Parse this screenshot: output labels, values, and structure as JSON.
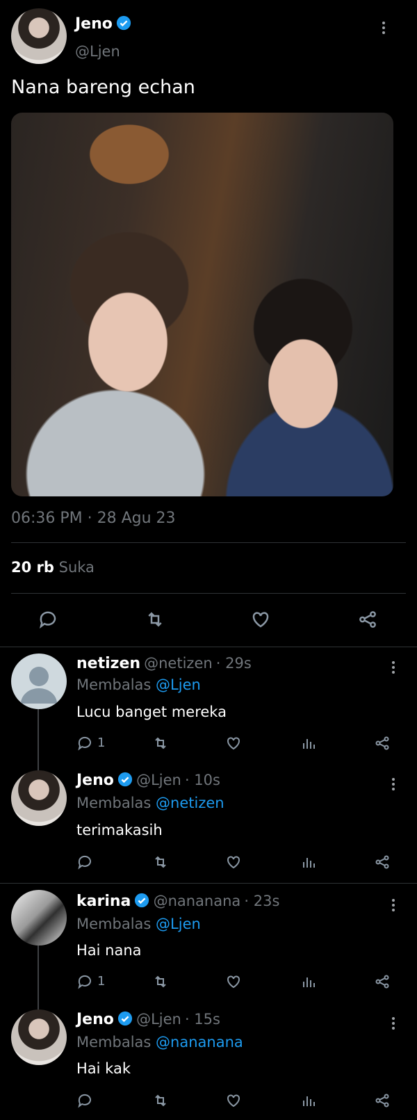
{
  "tweet": {
    "author_name": "Jeno",
    "author_handle": "@Ljen",
    "text": "Nana bareng echan",
    "timestamp": "06:36 PM · 28 Agu 23",
    "likes_count": "20 rb",
    "likes_label": "Suka",
    "photo_description_icon": "tweet-photo"
  },
  "replies": [
    {
      "name": "netizen",
      "handle": "@netizen",
      "time": "· 29s",
      "verified": false,
      "replying_prefix": "Membalas",
      "replying_to": "@Ljen",
      "text": "Lucu banget mereka",
      "reply_count": "1"
    },
    {
      "name": "Jeno",
      "handle": "@Ljen",
      "time": "· 10s",
      "verified": true,
      "replying_prefix": "Membalas",
      "replying_to": "@netizen",
      "text": "terimakasih",
      "reply_count": ""
    },
    {
      "name": "karina",
      "handle": "@nananana",
      "time": "· 23s",
      "verified": true,
      "replying_prefix": "Membalas",
      "replying_to": "@Ljen",
      "text": "Hai nana",
      "reply_count": "1"
    },
    {
      "name": "Jeno",
      "handle": "@Ljen",
      "time": "· 15s",
      "verified": true,
      "replying_prefix": "Membalas",
      "replying_to": "@nananana",
      "text": "Hai kak",
      "reply_count": ""
    }
  ],
  "colors": {
    "background": "#000000",
    "accent": "#1d9bf0",
    "muted": "#71767b",
    "divider": "#2f3336"
  }
}
